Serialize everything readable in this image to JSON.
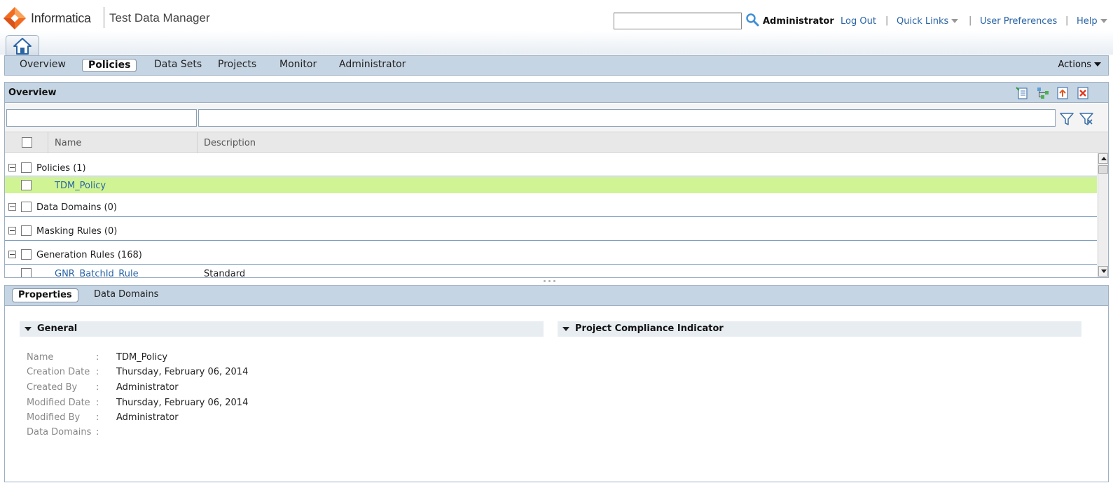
{
  "header": {
    "brand": "Informatica",
    "app_title": "Test Data Manager",
    "user": "Administrator",
    "log_out": "Log Out",
    "quick_links": "Quick Links",
    "user_preferences": "User Preferences",
    "help": "Help",
    "separator": "|",
    "search_value": ""
  },
  "nav": {
    "tabs": [
      {
        "label": "Overview",
        "active": false
      },
      {
        "label": "Policies",
        "active": true
      },
      {
        "label": "Data Sets",
        "active": false
      },
      {
        "label": "Projects",
        "active": false
      },
      {
        "label": "Monitor",
        "active": false
      },
      {
        "label": "Administrator",
        "active": false
      }
    ],
    "actions": "Actions"
  },
  "overview": {
    "title": "Overview",
    "filters": {
      "name": "",
      "description": ""
    },
    "columns": {
      "name": "Name",
      "description": "Description"
    },
    "groups": [
      {
        "label": "Policies (1)",
        "rows": [
          {
            "name": "TDM_Policy",
            "description": "",
            "selected": true
          }
        ]
      },
      {
        "label": "Data Domains (0)",
        "rows": []
      },
      {
        "label": "Masking Rules (0)",
        "rows": []
      },
      {
        "label": "Generation Rules (168)",
        "rows": [
          {
            "name": "GNR_BatchId_Rule",
            "description": "Standard",
            "selected": false
          }
        ]
      }
    ]
  },
  "properties": {
    "tabs": [
      {
        "label": "Properties",
        "active": true
      },
      {
        "label": "Data Domains",
        "active": false
      }
    ],
    "general": {
      "title": "General",
      "fields": [
        {
          "label": "Name",
          "value": "TDM_Policy"
        },
        {
          "label": "Creation Date",
          "value": "Thursday, February 06, 2014"
        },
        {
          "label": "Created By",
          "value": "Administrator"
        },
        {
          "label": "Modified Date",
          "value": "Thursday, February 06, 2014"
        },
        {
          "label": "Modified By",
          "value": "Administrator"
        },
        {
          "label": "Data Domains",
          "value": ""
        }
      ]
    },
    "compliance": {
      "title": "Project Compliance Indicator"
    },
    "colon": ":"
  },
  "colors": {
    "nav_bg": "#c6d5e3",
    "link": "#2a64a5",
    "selected_row": "#d0f494",
    "logo_orange": "#f26c22"
  }
}
